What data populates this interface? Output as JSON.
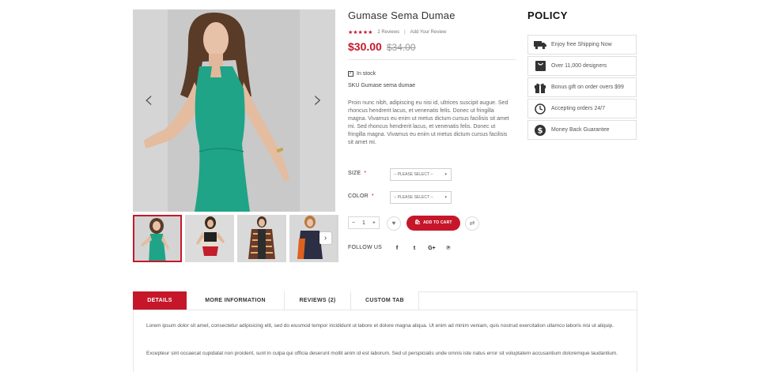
{
  "gallery": {
    "prev_arrow": "‹",
    "next_arrow": "›",
    "thumb_next": "›"
  },
  "product": {
    "title": "Gumase Sema Dumae",
    "stars": "★★★★★",
    "reviews_count": "2 Reviews",
    "rating_separator": "|",
    "add_review": "Add Your Review",
    "price": "$30.00",
    "old_price": "$34.00",
    "stock": "In stock",
    "stock_check": "✓",
    "sku": "SKU Gumase sema dumae",
    "description": "Proin nunc nibh, adipiscing eu nisi id, ultrices suscipit augue. Sed rhoncus hendrerit lacus, et venenatis felis. Donec ut fringilla magna. Vivamus eu enim ut metus dictum cursus facilisis sit amet mi. Sed rhoncus hendrerit lacus, et venenatis felis. Donec ut fringilla magna. Vivamus eu enim ut metus dictum cursus facilisis sit amet mi.",
    "size_label": "SIZE",
    "size_required": "*",
    "size_select": "-- PLEASE SELECT --",
    "color_label": "COLOR",
    "color_required": "*",
    "color_select": "-- PLEASE SELECT --",
    "select_caret": "▾",
    "qty_minus": "−",
    "qty_value": "1",
    "qty_plus": "+",
    "wishlist_glyph": "♥",
    "add_to_cart": "ADD TO CART",
    "cart_glyph": "🛍",
    "compare_glyph": "⇄",
    "follow_label": "FOLLOW US",
    "social": [
      {
        "name": "facebook",
        "glyph": "f"
      },
      {
        "name": "twitter",
        "glyph": "t"
      },
      {
        "name": "google-plus",
        "glyph": "G+"
      },
      {
        "name": "pinterest",
        "glyph": "℗"
      }
    ]
  },
  "policy": {
    "title": "POLICY",
    "items": [
      {
        "icon": "truck-icon",
        "label": "Enjoy free Shipping Now"
      },
      {
        "icon": "bag-icon",
        "label": "Over 11,000 designers"
      },
      {
        "icon": "gift-icon",
        "label": "Bonus gift on order overs $99"
      },
      {
        "icon": "clock-icon",
        "label": "Accepting orders 24/7"
      },
      {
        "icon": "dollar-icon",
        "label": "Money Back Guarantee"
      }
    ]
  },
  "tabs": {
    "items": [
      "DETAILS",
      "MORE INFORMATION",
      "REVIEWS (2)",
      "CUSTOM TAB"
    ],
    "active": "DETAILS",
    "paragraph1": "Lorem ipsum dolor sit amet, consectetur adipisicing elit, sed do eiusmod tempor incididunt ut labore et dolore magna aliqua. Ut enim ad minim veniam, quis nostrud exercitation ullamco laboris nisi ut aliquip.",
    "paragraph2": "Excepteur sint occaecat cupidatat non proident, sunt in culpa qui officia deserunt mollit anim id est laborum. Sed ut perspiciatis unde omnis iste natus error sit voluptatem accusantium doloremque laudantium."
  },
  "colors": {
    "accent": "#c6172a",
    "dress": "#1fa487",
    "background": "#ffffff"
  }
}
